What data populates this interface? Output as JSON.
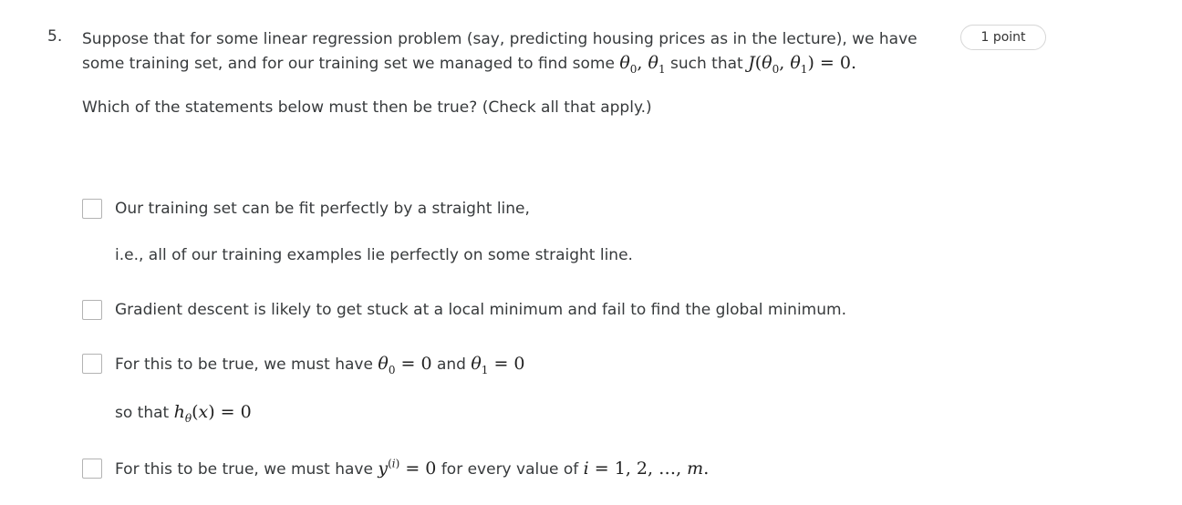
{
  "question": {
    "number": "5.",
    "text_line1": "Suppose that for some linear regression problem (say, predicting housing prices as in the lecture), we have",
    "text_line2_prefix": "some training set, and for our training set we managed to find some",
    "text_line2_middle": "such that",
    "prompt": "Which of the statements below must then be true? (Check all that apply.)",
    "points": "1 point"
  },
  "options": [
    {
      "line1": "Our training set can be fit perfectly by a straight line,",
      "line2": "i.e., all of our training examples lie perfectly on some straight line.",
      "checked": false
    },
    {
      "line1": "Gradient descent is likely to get stuck at a local minimum and fail to find the global minimum.",
      "checked": false
    },
    {
      "line1_prefix": "For this to be true, we must have",
      "line1_and": "and",
      "line2_prefix": "so that",
      "checked": false
    },
    {
      "line1_prefix": "For this to be true, we must have",
      "line1_mid": "for every value of",
      "checked": false
    }
  ]
}
